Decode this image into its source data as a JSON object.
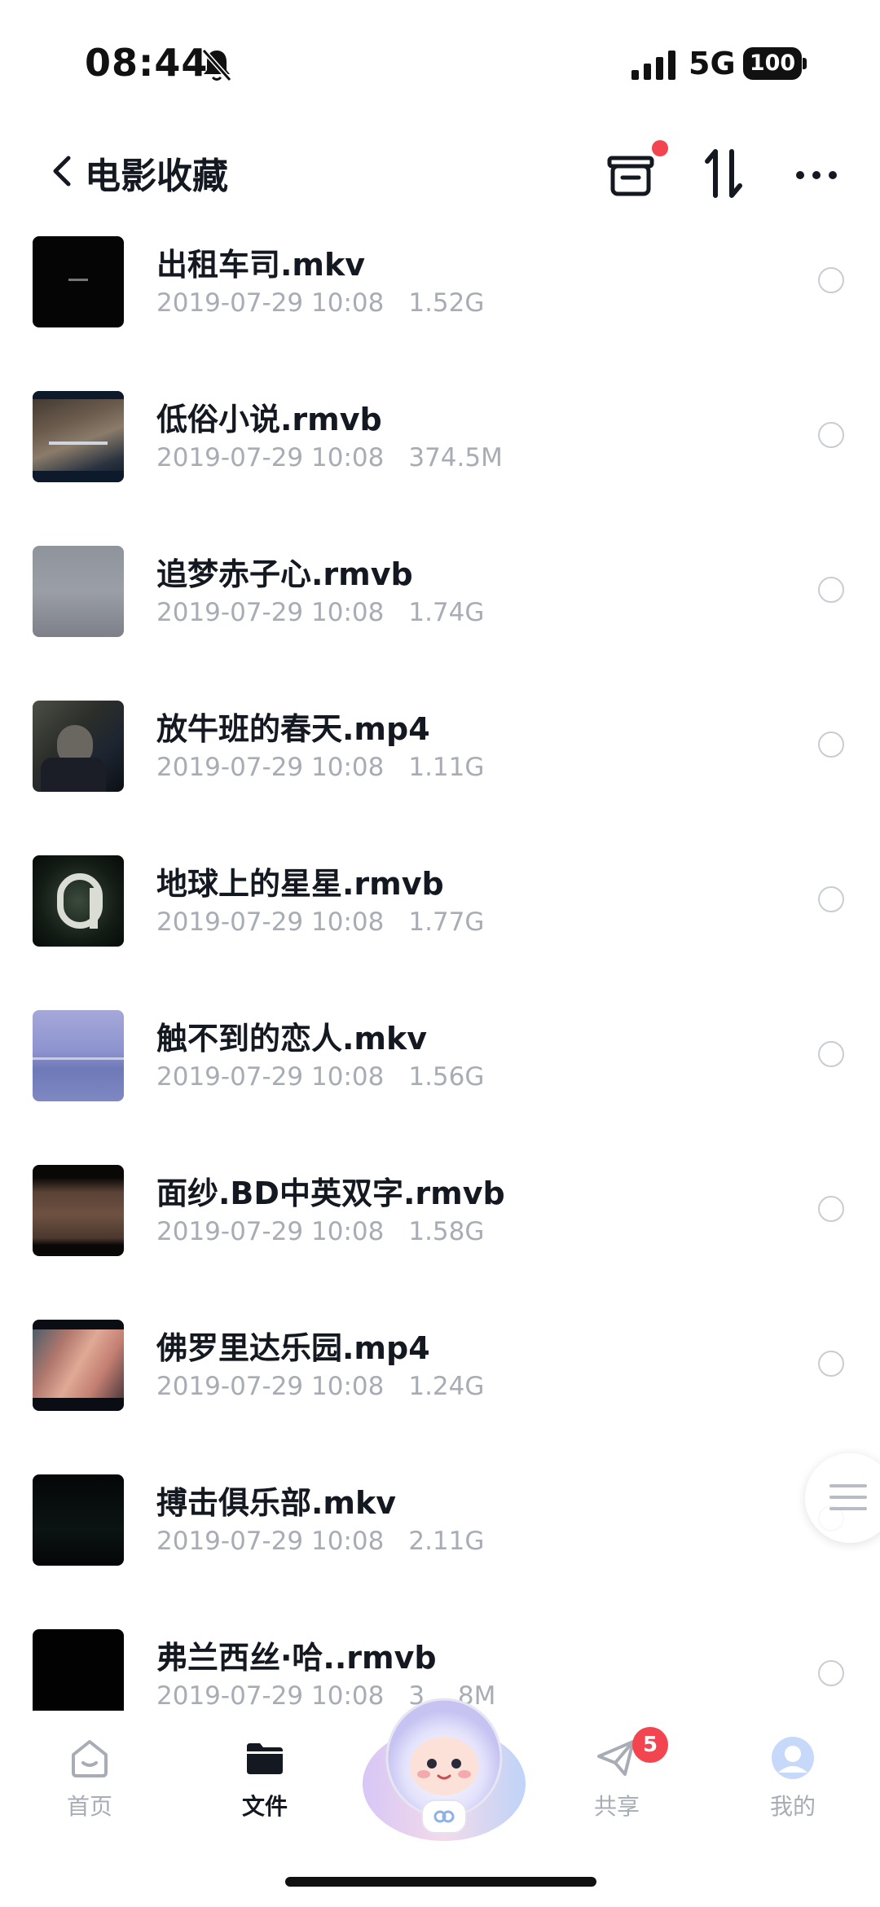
{
  "status_bar": {
    "time": "08:44",
    "network": "5G",
    "battery": "100"
  },
  "nav": {
    "title": "电影收藏"
  },
  "files": [
    {
      "name": "出租车司.mkv",
      "date": "2019-07-29 10:08",
      "size": "1.52G"
    },
    {
      "name": "低俗小说.rmvb",
      "date": "2019-07-29 10:08",
      "size": "374.5M"
    },
    {
      "name": "追梦赤子心.rmvb",
      "date": "2019-07-29 10:08",
      "size": "1.74G"
    },
    {
      "name": "放牛班的春天.mp4",
      "date": "2019-07-29 10:08",
      "size": "1.11G"
    },
    {
      "name": "地球上的星星.rmvb",
      "date": "2019-07-29 10:08",
      "size": "1.77G"
    },
    {
      "name": "触不到的恋人.mkv",
      "date": "2019-07-29 10:08",
      "size": "1.56G"
    },
    {
      "name": "面纱.BD中英双字.rmvb",
      "date": "2019-07-29 10:08",
      "size": "1.58G"
    },
    {
      "name": "佛罗里达乐园.mp4",
      "date": "2019-07-29 10:08",
      "size": "1.24G"
    },
    {
      "name": "搏击俱乐部.mkv",
      "date": "2019-07-29 10:08",
      "size": "2.11G"
    },
    {
      "name": "弗兰西丝·哈..rmvb",
      "date": "2019-07-29 10:08",
      "size": "3.…8M"
    }
  ],
  "tabs": {
    "home": "首页",
    "files": "文件",
    "share": "共享",
    "share_badge": "5",
    "mine": "我的"
  },
  "colors": {
    "accent_red": "#f2454f",
    "text_primary": "#141821",
    "text_secondary": "#a7acb5"
  }
}
